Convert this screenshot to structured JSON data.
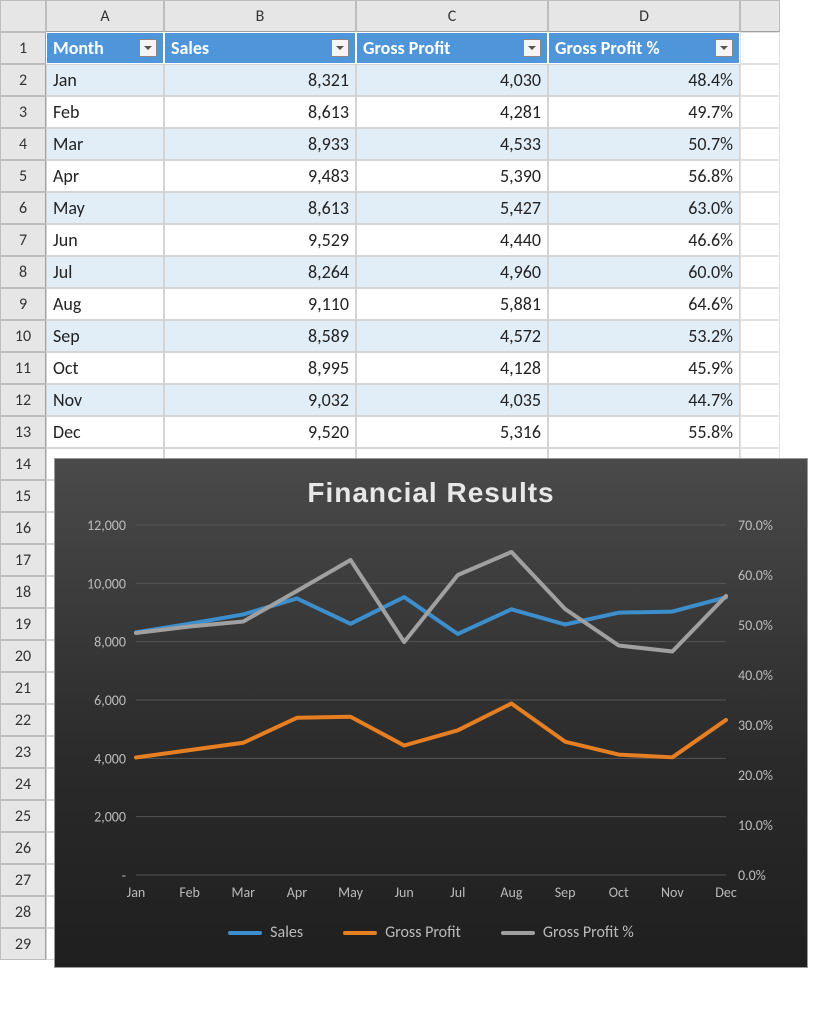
{
  "columns": [
    "A",
    "B",
    "C",
    "D"
  ],
  "row_numbers": [
    1,
    2,
    3,
    4,
    5,
    6,
    7,
    8,
    9,
    10,
    11,
    12,
    13,
    14,
    15,
    16,
    17,
    18,
    19,
    20,
    21,
    22,
    23,
    24,
    25,
    26,
    27,
    28,
    29
  ],
  "header": {
    "month": "Month",
    "sales": "Sales",
    "gross_profit": "Gross Profit",
    "gross_profit_pct": "Gross Profit %"
  },
  "rows": [
    {
      "month": "Jan",
      "sales": "8,321",
      "gp": "4,030",
      "pct": "48.4%"
    },
    {
      "month": "Feb",
      "sales": "8,613",
      "gp": "4,281",
      "pct": "49.7%"
    },
    {
      "month": "Mar",
      "sales": "8,933",
      "gp": "4,533",
      "pct": "50.7%"
    },
    {
      "month": "Apr",
      "sales": "9,483",
      "gp": "5,390",
      "pct": "56.8%"
    },
    {
      "month": "May",
      "sales": "8,613",
      "gp": "5,427",
      "pct": "63.0%"
    },
    {
      "month": "Jun",
      "sales": "9,529",
      "gp": "4,440",
      "pct": "46.6%"
    },
    {
      "month": "Jul",
      "sales": "8,264",
      "gp": "4,960",
      "pct": "60.0%"
    },
    {
      "month": "Aug",
      "sales": "9,110",
      "gp": "5,881",
      "pct": "64.6%"
    },
    {
      "month": "Sep",
      "sales": "8,589",
      "gp": "4,572",
      "pct": "53.2%"
    },
    {
      "month": "Oct",
      "sales": "8,995",
      "gp": "4,128",
      "pct": "45.9%"
    },
    {
      "month": "Nov",
      "sales": "9,032",
      "gp": "4,035",
      "pct": "44.7%"
    },
    {
      "month": "Dec",
      "sales": "9,520",
      "gp": "5,316",
      "pct": "55.8%"
    }
  ],
  "chart": {
    "title": "Financial Results",
    "legend": {
      "sales": "Sales",
      "gp": "Gross Profit",
      "pct": "Gross Profit %"
    },
    "colors": {
      "sales": "#3d8ecc",
      "gp": "#e67e22",
      "pct": "#a0a0a0",
      "grid": "#555",
      "axis_text": "#bbb"
    }
  },
  "chart_data": {
    "type": "line",
    "title": "Financial Results",
    "categories": [
      "Jan",
      "Feb",
      "Mar",
      "Apr",
      "May",
      "Jun",
      "Jul",
      "Aug",
      "Sep",
      "Oct",
      "Nov",
      "Dec"
    ],
    "series": [
      {
        "name": "Sales",
        "axis": "left",
        "values": [
          8321,
          8613,
          8933,
          9483,
          8613,
          9529,
          8264,
          9110,
          8589,
          8995,
          9032,
          9520
        ]
      },
      {
        "name": "Gross Profit",
        "axis": "left",
        "values": [
          4030,
          4281,
          4533,
          5390,
          5427,
          4440,
          4960,
          5881,
          4572,
          4128,
          4035,
          5316
        ]
      },
      {
        "name": "Gross Profit %",
        "axis": "right",
        "values": [
          48.4,
          49.7,
          50.7,
          56.8,
          63.0,
          46.6,
          60.0,
          64.6,
          53.2,
          45.9,
          44.7,
          55.8
        ]
      }
    ],
    "y_left": {
      "min": 0,
      "max": 12000,
      "ticks": [
        0,
        2000,
        4000,
        6000,
        8000,
        10000,
        12000
      ],
      "tick_labels": [
        "-",
        "2,000",
        "4,000",
        "6,000",
        "8,000",
        "10,000",
        "12,000"
      ]
    },
    "y_right": {
      "min": 0,
      "max": 70,
      "ticks": [
        0,
        10,
        20,
        30,
        40,
        50,
        60,
        70
      ],
      "tick_labels": [
        "0.0%",
        "10.0%",
        "20.0%",
        "30.0%",
        "40.0%",
        "50.0%",
        "60.0%",
        "70.0%"
      ]
    }
  }
}
